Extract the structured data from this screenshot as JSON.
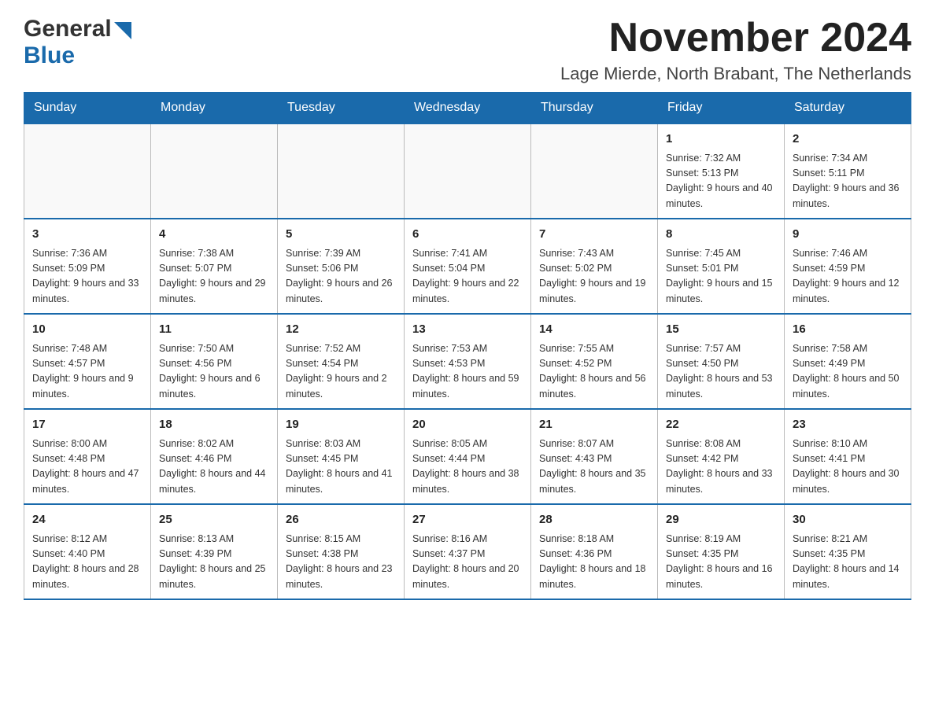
{
  "logo": {
    "general": "General",
    "blue": "Blue",
    "arrow": "▶"
  },
  "header": {
    "month_year": "November 2024",
    "location": "Lage Mierde, North Brabant, The Netherlands"
  },
  "weekdays": [
    "Sunday",
    "Monday",
    "Tuesday",
    "Wednesday",
    "Thursday",
    "Friday",
    "Saturday"
  ],
  "weeks": [
    {
      "days": [
        {
          "num": "",
          "info": ""
        },
        {
          "num": "",
          "info": ""
        },
        {
          "num": "",
          "info": ""
        },
        {
          "num": "",
          "info": ""
        },
        {
          "num": "",
          "info": ""
        },
        {
          "num": "1",
          "info": "Sunrise: 7:32 AM\nSunset: 5:13 PM\nDaylight: 9 hours and 40 minutes."
        },
        {
          "num": "2",
          "info": "Sunrise: 7:34 AM\nSunset: 5:11 PM\nDaylight: 9 hours and 36 minutes."
        }
      ]
    },
    {
      "days": [
        {
          "num": "3",
          "info": "Sunrise: 7:36 AM\nSunset: 5:09 PM\nDaylight: 9 hours and 33 minutes."
        },
        {
          "num": "4",
          "info": "Sunrise: 7:38 AM\nSunset: 5:07 PM\nDaylight: 9 hours and 29 minutes."
        },
        {
          "num": "5",
          "info": "Sunrise: 7:39 AM\nSunset: 5:06 PM\nDaylight: 9 hours and 26 minutes."
        },
        {
          "num": "6",
          "info": "Sunrise: 7:41 AM\nSunset: 5:04 PM\nDaylight: 9 hours and 22 minutes."
        },
        {
          "num": "7",
          "info": "Sunrise: 7:43 AM\nSunset: 5:02 PM\nDaylight: 9 hours and 19 minutes."
        },
        {
          "num": "8",
          "info": "Sunrise: 7:45 AM\nSunset: 5:01 PM\nDaylight: 9 hours and 15 minutes."
        },
        {
          "num": "9",
          "info": "Sunrise: 7:46 AM\nSunset: 4:59 PM\nDaylight: 9 hours and 12 minutes."
        }
      ]
    },
    {
      "days": [
        {
          "num": "10",
          "info": "Sunrise: 7:48 AM\nSunset: 4:57 PM\nDaylight: 9 hours and 9 minutes."
        },
        {
          "num": "11",
          "info": "Sunrise: 7:50 AM\nSunset: 4:56 PM\nDaylight: 9 hours and 6 minutes."
        },
        {
          "num": "12",
          "info": "Sunrise: 7:52 AM\nSunset: 4:54 PM\nDaylight: 9 hours and 2 minutes."
        },
        {
          "num": "13",
          "info": "Sunrise: 7:53 AM\nSunset: 4:53 PM\nDaylight: 8 hours and 59 minutes."
        },
        {
          "num": "14",
          "info": "Sunrise: 7:55 AM\nSunset: 4:52 PM\nDaylight: 8 hours and 56 minutes."
        },
        {
          "num": "15",
          "info": "Sunrise: 7:57 AM\nSunset: 4:50 PM\nDaylight: 8 hours and 53 minutes."
        },
        {
          "num": "16",
          "info": "Sunrise: 7:58 AM\nSunset: 4:49 PM\nDaylight: 8 hours and 50 minutes."
        }
      ]
    },
    {
      "days": [
        {
          "num": "17",
          "info": "Sunrise: 8:00 AM\nSunset: 4:48 PM\nDaylight: 8 hours and 47 minutes."
        },
        {
          "num": "18",
          "info": "Sunrise: 8:02 AM\nSunset: 4:46 PM\nDaylight: 8 hours and 44 minutes."
        },
        {
          "num": "19",
          "info": "Sunrise: 8:03 AM\nSunset: 4:45 PM\nDaylight: 8 hours and 41 minutes."
        },
        {
          "num": "20",
          "info": "Sunrise: 8:05 AM\nSunset: 4:44 PM\nDaylight: 8 hours and 38 minutes."
        },
        {
          "num": "21",
          "info": "Sunrise: 8:07 AM\nSunset: 4:43 PM\nDaylight: 8 hours and 35 minutes."
        },
        {
          "num": "22",
          "info": "Sunrise: 8:08 AM\nSunset: 4:42 PM\nDaylight: 8 hours and 33 minutes."
        },
        {
          "num": "23",
          "info": "Sunrise: 8:10 AM\nSunset: 4:41 PM\nDaylight: 8 hours and 30 minutes."
        }
      ]
    },
    {
      "days": [
        {
          "num": "24",
          "info": "Sunrise: 8:12 AM\nSunset: 4:40 PM\nDaylight: 8 hours and 28 minutes."
        },
        {
          "num": "25",
          "info": "Sunrise: 8:13 AM\nSunset: 4:39 PM\nDaylight: 8 hours and 25 minutes."
        },
        {
          "num": "26",
          "info": "Sunrise: 8:15 AM\nSunset: 4:38 PM\nDaylight: 8 hours and 23 minutes."
        },
        {
          "num": "27",
          "info": "Sunrise: 8:16 AM\nSunset: 4:37 PM\nDaylight: 8 hours and 20 minutes."
        },
        {
          "num": "28",
          "info": "Sunrise: 8:18 AM\nSunset: 4:36 PM\nDaylight: 8 hours and 18 minutes."
        },
        {
          "num": "29",
          "info": "Sunrise: 8:19 AM\nSunset: 4:35 PM\nDaylight: 8 hours and 16 minutes."
        },
        {
          "num": "30",
          "info": "Sunrise: 8:21 AM\nSunset: 4:35 PM\nDaylight: 8 hours and 14 minutes."
        }
      ]
    }
  ],
  "colors": {
    "header_bg": "#1a6aab",
    "header_text": "#ffffff",
    "border": "#bbbbbb",
    "row_border": "#1a6aab"
  }
}
